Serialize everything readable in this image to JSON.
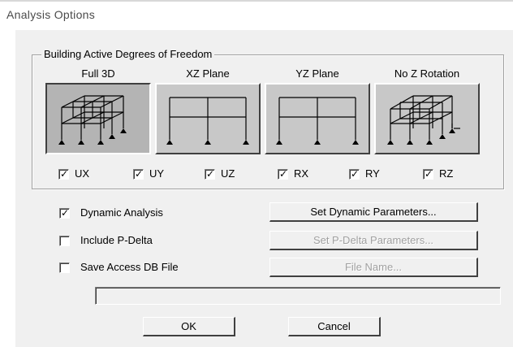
{
  "window": {
    "title": "Analysis Options"
  },
  "dof_group": {
    "legend": "Building Active Degrees of Freedom",
    "planes": [
      {
        "label": "Full 3D",
        "icon": "full-3d-frame-icon",
        "pressed": true
      },
      {
        "label": "XZ Plane",
        "icon": "xz-plane-frame-icon",
        "pressed": false
      },
      {
        "label": "YZ Plane",
        "icon": "yz-plane-frame-icon",
        "pressed": false
      },
      {
        "label": "No Z Rotation",
        "icon": "no-z-rotation-frame-icon",
        "pressed": false
      }
    ],
    "dofs": [
      {
        "label": "UX",
        "checked": true
      },
      {
        "label": "UY",
        "checked": true
      },
      {
        "label": "UZ",
        "checked": true
      },
      {
        "label": "RX",
        "checked": true
      },
      {
        "label": "RY",
        "checked": true
      },
      {
        "label": "RZ",
        "checked": true
      }
    ]
  },
  "options": {
    "dynamic": {
      "label": "Dynamic Analysis",
      "checked": true,
      "button": "Set Dynamic Parameters...",
      "button_enabled": true
    },
    "pdelta": {
      "label": "Include P-Delta",
      "checked": false,
      "button": "Set P-Delta Parameters...",
      "button_enabled": false
    },
    "accessdb": {
      "label": "Save Access DB File",
      "checked": false,
      "button": "File Name...",
      "button_enabled": false
    }
  },
  "file_path": {
    "value": ""
  },
  "footer": {
    "ok": "OK",
    "cancel": "Cancel"
  },
  "colors": {
    "face": "#f0f0f0",
    "button_face": "#c8c8c8",
    "disabled_text": "#a0a0a0"
  }
}
